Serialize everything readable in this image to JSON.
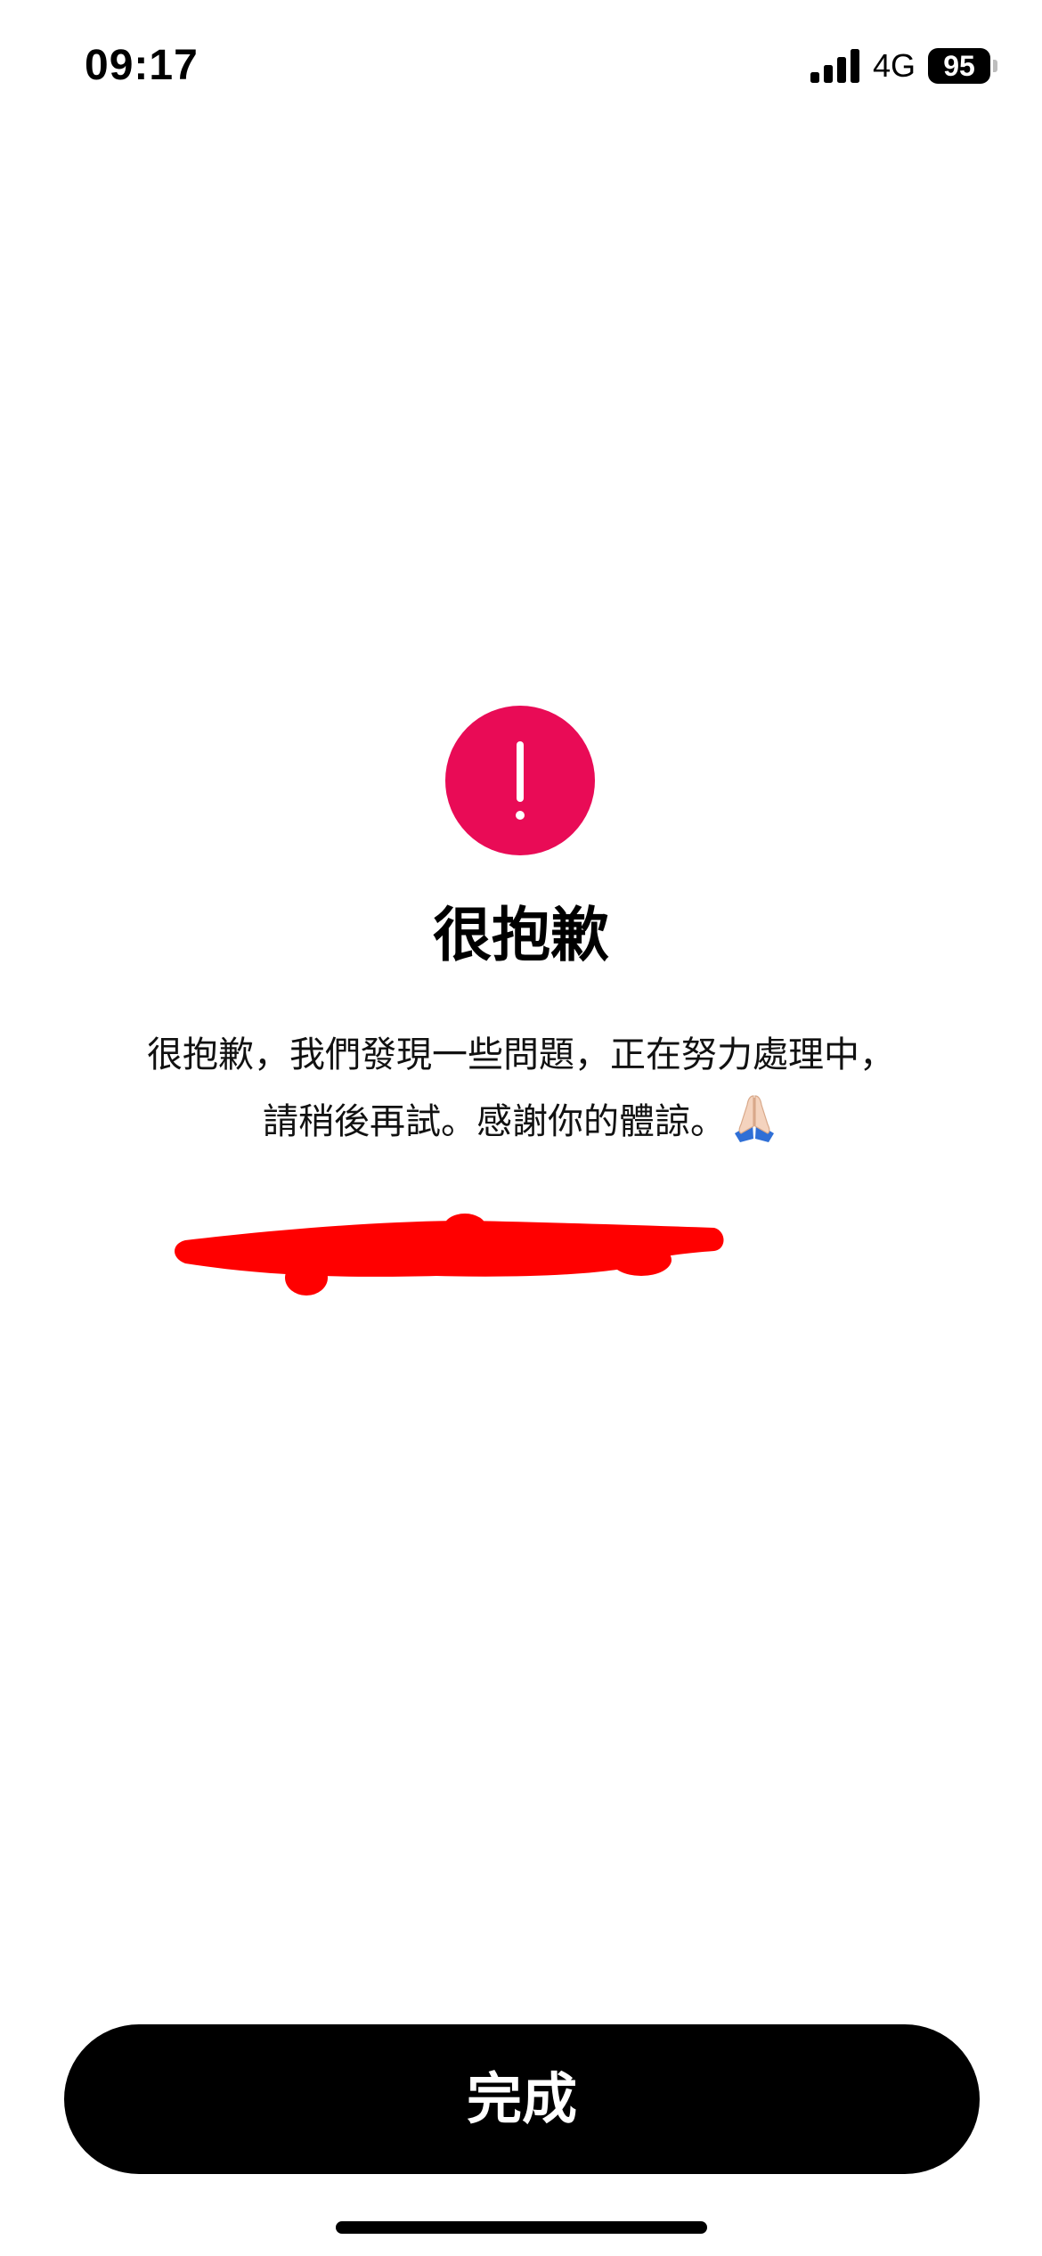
{
  "status_bar": {
    "time": "09:17",
    "network": "4G",
    "battery_level": "95",
    "signal_bars": 4
  },
  "error": {
    "icon": "exclamation-circle-icon",
    "icon_color": "#E90B56",
    "title": "很抱歉",
    "message_line_1": "很抱歉，我們發現一些問題，正在努力處理中，",
    "message_line_2": "請稍後再試。感謝你的體諒。",
    "message_emoji": "folded-hands-icon",
    "redaction_color": "#FF0000"
  },
  "actions": {
    "done_label": "完成"
  }
}
